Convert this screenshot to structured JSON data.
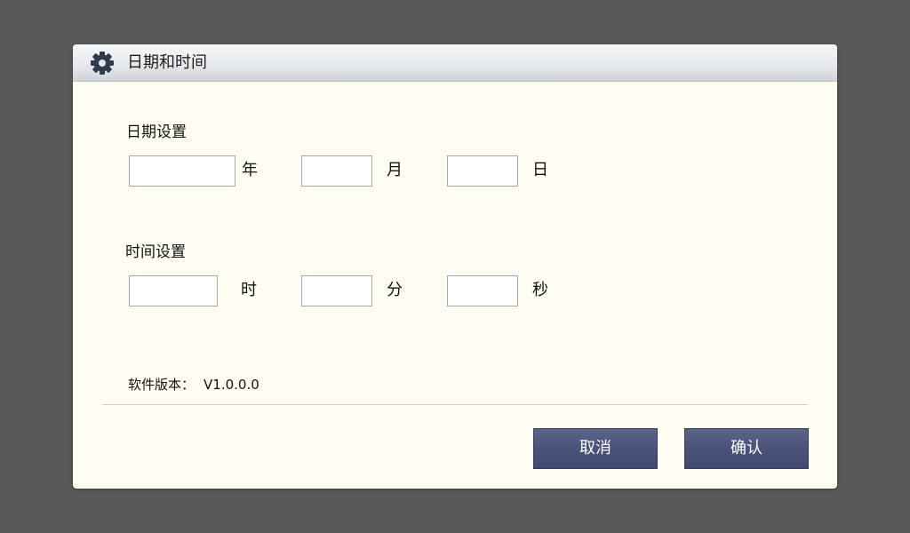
{
  "dialog": {
    "title": "日期和时间",
    "icon": "gear-icon"
  },
  "date_section": {
    "label": "日期设置",
    "year_value": "",
    "year_unit": "年",
    "month_value": "",
    "month_unit": "月",
    "day_value": "",
    "day_unit": "日"
  },
  "time_section": {
    "label": "时间设置",
    "hour_value": "",
    "hour_unit": "时",
    "minute_value": "",
    "minute_unit": "分",
    "second_value": "",
    "second_unit": "秒"
  },
  "version": {
    "label": "软件版本：",
    "value": "V1.0.0.0"
  },
  "buttons": {
    "cancel": "取消",
    "confirm": "确认"
  },
  "colors": {
    "backdrop": "#595959",
    "dialog_bg": "#fffdf1",
    "button_bg": "#48527a",
    "button_text": "#ffffff",
    "icon": "#2f3a4d"
  }
}
